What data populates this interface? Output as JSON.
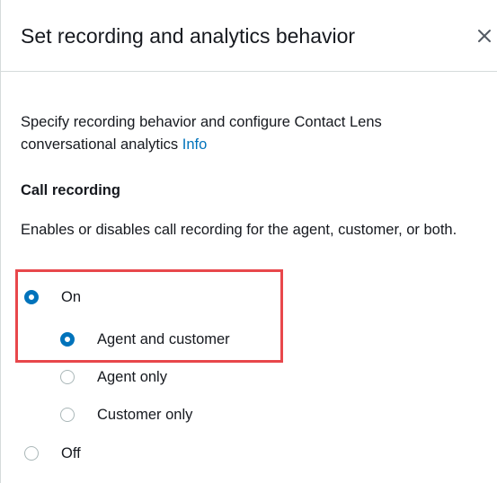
{
  "header": {
    "title": "Set recording and analytics behavior",
    "close_icon": "close-icon"
  },
  "intro": {
    "text": "Specify recording behavior and configure Contact Lens conversational analytics ",
    "info_link": "Info"
  },
  "call_recording": {
    "title": "Call recording",
    "help": "Enables or disables call recording for the agent, customer, or both.",
    "on_label": "On",
    "off_label": "Off",
    "selected": "On",
    "sub_options": [
      "Agent and customer",
      "Agent only",
      "Customer only"
    ],
    "sub_selected": "Agent and customer"
  },
  "colors": {
    "accent": "#0073bb",
    "highlight": "#e8474b",
    "radio_border": "#aab7b8"
  }
}
